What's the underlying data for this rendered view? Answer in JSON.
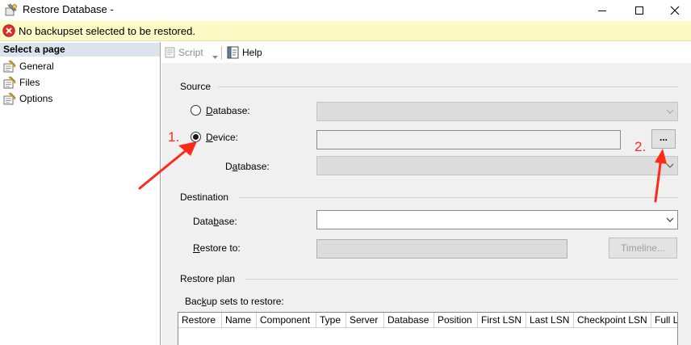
{
  "window": {
    "title": "Restore Database -",
    "icon": "restore-database-icon"
  },
  "error_bar": {
    "icon": "error-icon",
    "message": "No backupset selected to be restored."
  },
  "nav": {
    "header": "Select a page",
    "items": [
      {
        "label": "General",
        "icon": "page-icon"
      },
      {
        "label": "Files",
        "icon": "page-icon"
      },
      {
        "label": "Options",
        "icon": "page-icon"
      }
    ]
  },
  "toolbar": {
    "script_label": "Script",
    "help_label": "Help"
  },
  "source": {
    "title": "Source",
    "database_radio_pre": "",
    "database_radio_ul": "D",
    "database_radio_post": "atabase:",
    "device_radio_pre": "",
    "device_radio_ul": "D",
    "device_radio_post": "evice:",
    "device_value": "",
    "browse_label": "...",
    "device_database_pre": "D",
    "device_database_ul": "a",
    "device_database_post": "tabase:",
    "selected": "device"
  },
  "destination": {
    "title": "Destination",
    "database_pre": "Data",
    "database_ul": "b",
    "database_post": "ase:",
    "database_value": "",
    "restore_to_pre": "",
    "restore_to_ul": "R",
    "restore_to_post": "estore to:",
    "restore_to_value": "",
    "timeline_label": "Timeline..."
  },
  "restore_plan": {
    "title": "Restore plan",
    "backup_sets_pre": "Bac",
    "backup_sets_ul": "k",
    "backup_sets_post": "up sets to restore:",
    "columns": [
      "Restore",
      "Name",
      "Component",
      "Type",
      "Server",
      "Database",
      "Position",
      "First LSN",
      "Last LSN",
      "Checkpoint LSN",
      "Full LSN"
    ]
  },
  "annotations": {
    "step1": "1.",
    "step2": "2.",
    "color": "#ff2a1a"
  }
}
